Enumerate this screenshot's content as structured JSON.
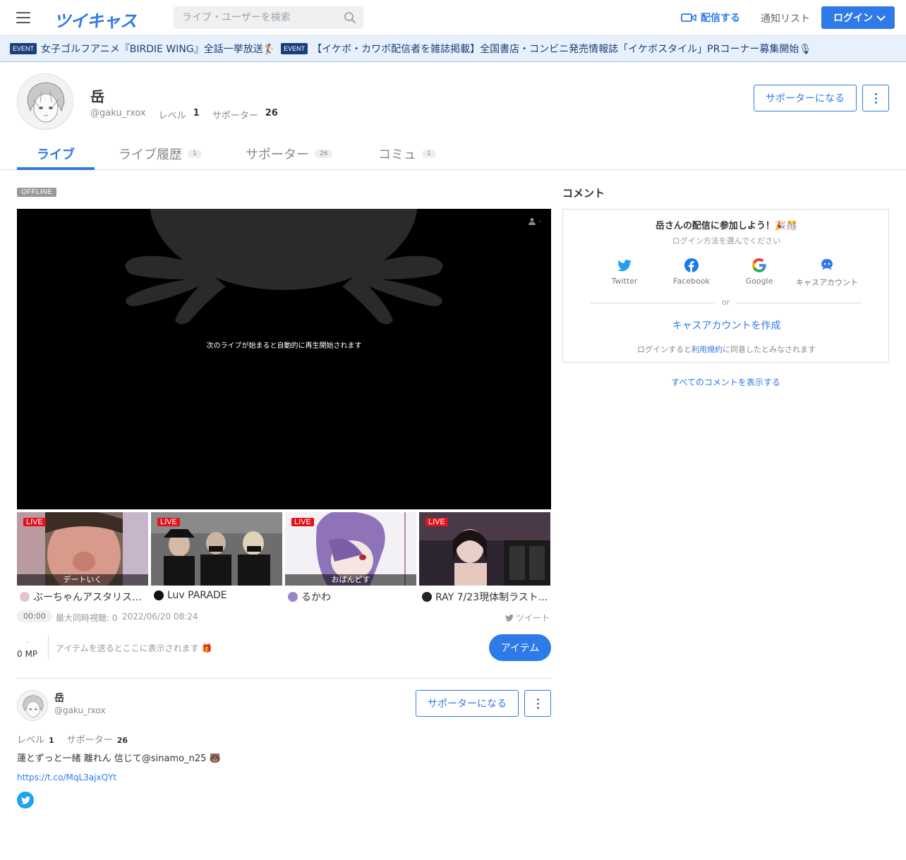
{
  "header": {
    "logo": "ツイキャス",
    "search_placeholder": "ライブ・ユーザーを検索",
    "broadcast_label": "配信する",
    "notification_label": "通知リスト",
    "login_label": "ログイン"
  },
  "eventbar": {
    "items": [
      {
        "badge": "EVENT",
        "text": "女子ゴルフアニメ『BIRDIE WING』全話一挙放送🏌"
      },
      {
        "badge": "EVENT",
        "text": "【イケボ・カワボ配信者を雑誌掲載】全国書店・コンビニ発売情報誌「イケボスタイル」PRコーナー募集開始🎙"
      }
    ]
  },
  "profile": {
    "name": "岳",
    "handle": "@gaku_rxox",
    "level_label": "レベル",
    "level": "1",
    "supporters_label": "サポーター",
    "supporters": "26",
    "support_button": "サポーターになる"
  },
  "tabs": [
    {
      "label": "ライブ",
      "count": ""
    },
    {
      "label": "ライブ履歴",
      "count": "1"
    },
    {
      "label": "サポーター",
      "count": "26"
    },
    {
      "label": "コミュ",
      "count": "1"
    }
  ],
  "player": {
    "status": "OFFLINE",
    "message": "次のライブが始まると自動的に再生開始されます",
    "viewer_count": "-"
  },
  "thumbs": [
    {
      "live": "LIVE",
      "caption": "デートいく",
      "title": "ぶーちゃんアスタリスク...",
      "color": "#8a6a55"
    },
    {
      "live": "LIVE",
      "caption": "",
      "title": "Luv PARADE",
      "color": "#6b6b6b"
    },
    {
      "live": "LIVE",
      "caption": "おばんどす",
      "title": "るかわ",
      "color": "#9a86c4"
    },
    {
      "live": "LIVE",
      "caption": "",
      "title": "RAY 7/23現体制ラスト...",
      "color": "#5a4a58"
    }
  ],
  "stats": {
    "timer": "00:00",
    "max_viewers": "最大同時視聴: 0",
    "date": "2022/06/20 08:24",
    "tweet": "ツイート"
  },
  "items": {
    "mp_dash": "-",
    "mp_value": "0 MP",
    "hint": "アイテムを送るとここに表示されます 🎁",
    "button": "アイテム"
  },
  "lower_profile": {
    "name": "岳",
    "handle": "@gaku_rxox",
    "level_label": "レベル",
    "level": "1",
    "supporters_label": "サポーター",
    "supporters": "26",
    "support_button": "サポーターになる",
    "bio": "蓮とずっと一緒 離れん 信じて@sinamo_n25 🐻",
    "link": "https://t.co/MqL3ajxQYt"
  },
  "comments": {
    "title": "コメント",
    "join_text": "岳さんの配信に参加しよう！🎉🎊",
    "choose_login": "ログイン方法を選んでください",
    "sns": [
      "Twitter",
      "Facebook",
      "Google",
      "キャスアカウント"
    ],
    "or": "or",
    "create_account": "キャスアカウントを作成",
    "terms_prefix": "ログインすると",
    "terms_link": "利用規約",
    "terms_suffix": "に同意したとみなされます",
    "show_all": "すべてのコメントを表示する"
  },
  "colors": {
    "accent": "#2e7ae8",
    "live_red": "#e0121b",
    "event_navy": "#1b3f7a"
  }
}
